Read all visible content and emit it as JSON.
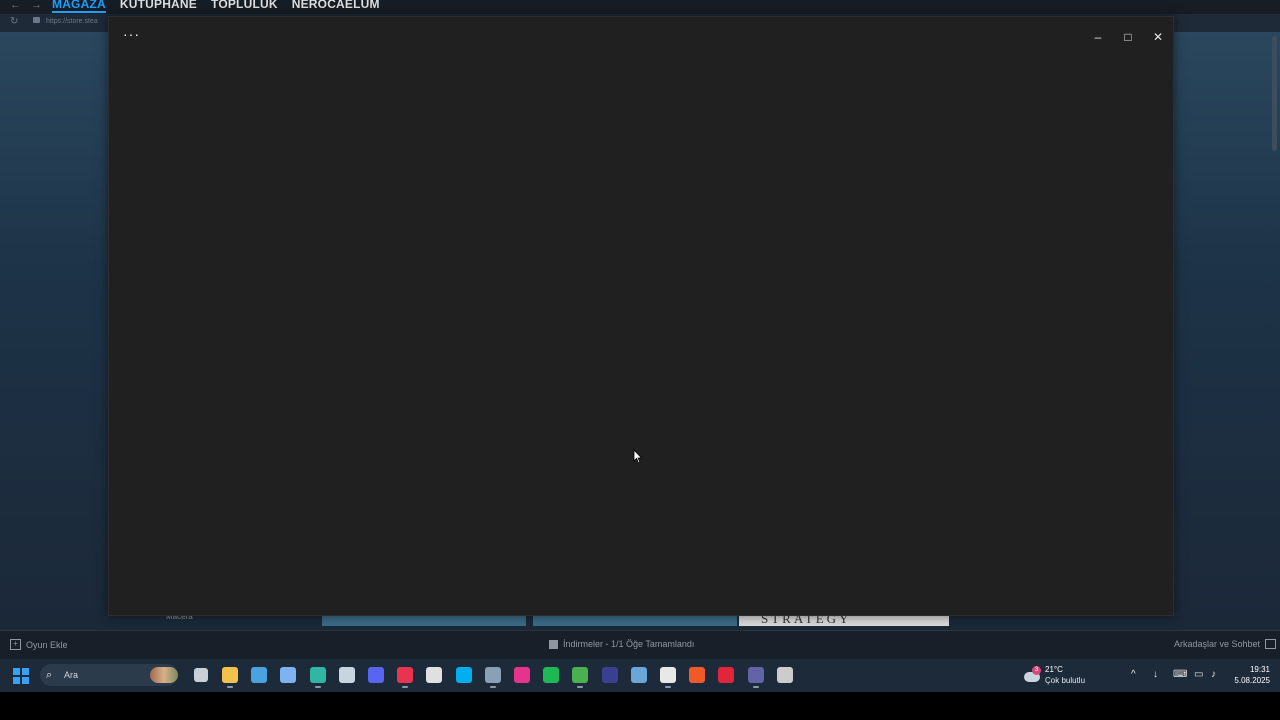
{
  "steam": {
    "nav": {
      "back": "←",
      "forward": "→",
      "tabs": [
        "MAĞAZA",
        "KÜTÜPHANE",
        "TOPLULUK",
        "NEROCAELUM"
      ]
    },
    "url": "https://store.stea",
    "category_label": "Macera",
    "tile_text": "STRATEGY",
    "bottom_bar": {
      "add_game": "Oyun Ekle",
      "downloads": "İndirmeler - 1/1 Öğe Tamamlandı",
      "friends": "Arkadaşlar ve Sohbet"
    }
  },
  "popup": {
    "more_label": "···",
    "minimize": "–",
    "maximize": "□",
    "close": "✕"
  },
  "taskbar": {
    "search_placeholder": "Ara",
    "search_glass": "⌕",
    "icons": [
      {
        "name": "file-explorer-icon",
        "color": "#f2c14e"
      },
      {
        "name": "settings-icon",
        "color": "#4aa3df"
      },
      {
        "name": "copilot-icon",
        "color": "#7fb2f0"
      },
      {
        "name": "edge-icon",
        "color": "#2fb7a3"
      },
      {
        "name": "steam-icon",
        "color": "#c7d5e0"
      },
      {
        "name": "discord-icon",
        "color": "#5865f2"
      },
      {
        "name": "opera-gx-icon",
        "color": "#e8344e"
      },
      {
        "name": "epic-games-icon",
        "color": "#e0e0e0"
      },
      {
        "name": "skype-icon",
        "color": "#00aff0"
      },
      {
        "name": "network-icon",
        "color": "#8aa0b4"
      },
      {
        "name": "app-pink-icon",
        "color": "#e6348c"
      },
      {
        "name": "spotify-icon",
        "color": "#1db954"
      },
      {
        "name": "minecraft-icon",
        "color": "#4caf50"
      },
      {
        "name": "mm-app-icon",
        "color": "#3b3f8f"
      },
      {
        "name": "dev-tool-icon",
        "color": "#6aa6d8"
      },
      {
        "name": "calendar-icon",
        "color": "#e8e8e8"
      },
      {
        "name": "ea-app-icon",
        "color": "#f05a28"
      },
      {
        "name": "red-app-icon",
        "color": "#e0263a"
      },
      {
        "name": "teams-icon",
        "color": "#6264a7"
      },
      {
        "name": "clock-app-icon",
        "color": "#cccccc"
      }
    ],
    "weather": {
      "badge": "3",
      "temp": "21°C",
      "condition": "Çok bulutlu"
    },
    "tray": {
      "chevron": "^",
      "mic": "↓",
      "keyboard": "⌨",
      "display": "▭",
      "volume": "♪"
    },
    "clock": {
      "time": "19:31",
      "date": "5.08.2025"
    }
  }
}
